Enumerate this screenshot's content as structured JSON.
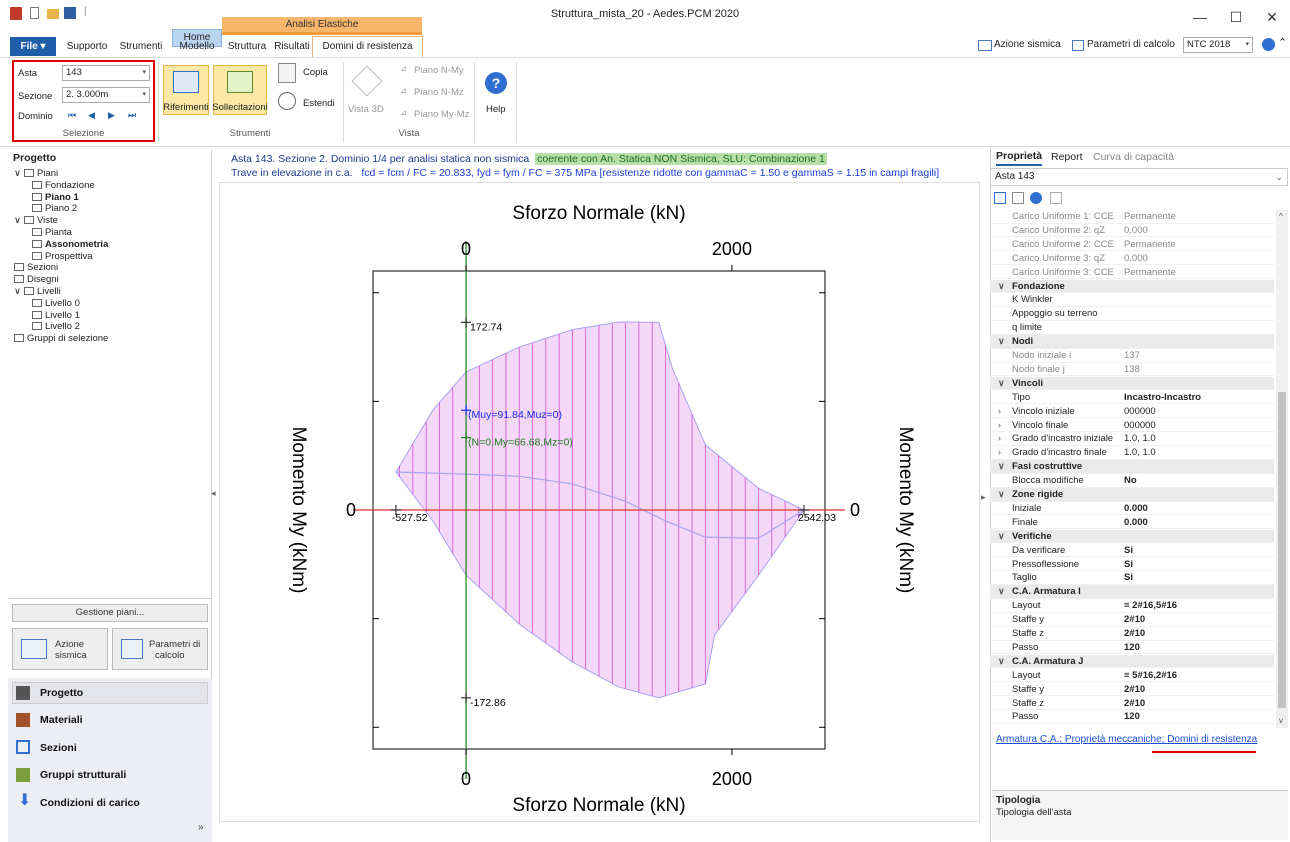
{
  "window": {
    "title": "Struttura_mista_20 - Aedes.PCM 2020",
    "minimize": "—",
    "maximize": "☐",
    "close": "✕"
  },
  "menu": {
    "file": "File ▾",
    "tabs": [
      "Supporto",
      "Strumenti",
      "Home",
      "Modello",
      "Struttura",
      "Risultati"
    ],
    "context_header": "Analisi Elastiche",
    "active_tab": "Domini di resistenza"
  },
  "topright": {
    "azione_sismica": "Azione sismica",
    "parametri_calcolo": "Parametri di calcolo",
    "norma": "NTC 2018"
  },
  "ribbon": {
    "selezione": {
      "label": "Selezione",
      "asta_label": "Asta",
      "asta_value": "143",
      "sezione_label": "Sezione",
      "sezione_value": "2. 3.000m",
      "dominio_label": "Dominio",
      "nav": [
        "⏮",
        "◀",
        "▶",
        "⏭"
      ]
    },
    "strumenti": {
      "label": "Strumenti",
      "riferimenti": "Riferimenti",
      "sollecitazioni": "Sollecitazioni",
      "copia": "Copia",
      "estendi": "Estendi"
    },
    "vista": {
      "label": "Vista",
      "vista3d": "Vista 3D",
      "piano_nmy": "Piano N-My",
      "piano_nmz": "Piano N-Mz",
      "piano_mymz": "Piano My-Mz"
    },
    "help": "Help"
  },
  "left_panel": {
    "title": "Progetto",
    "tree": [
      {
        "label": "Piani",
        "level": 0,
        "expand": "∨"
      },
      {
        "label": "Fondazione",
        "level": 1
      },
      {
        "label": "Piano 1",
        "level": 1,
        "bold": true
      },
      {
        "label": "Piano 2",
        "level": 1
      },
      {
        "label": "Viste",
        "level": 0,
        "expand": "∨"
      },
      {
        "label": "Pianta",
        "level": 1
      },
      {
        "label": "Assonometria",
        "level": 1,
        "bold": true
      },
      {
        "label": "Prospettiva",
        "level": 1
      },
      {
        "label": "Sezioni",
        "level": 0
      },
      {
        "label": "Disegni",
        "level": 0
      },
      {
        "label": "Livelli",
        "level": 0,
        "expand": "∨"
      },
      {
        "label": "Livello 0",
        "level": 1
      },
      {
        "label": "Livello 1",
        "level": 1
      },
      {
        "label": "Livello 2",
        "level": 1
      },
      {
        "label": "Gruppi di selezione",
        "level": 0
      }
    ],
    "gestione_piani": "Gestione piani...",
    "azione_sismica_btn": [
      "Azione",
      "sismica"
    ],
    "parametri_btn": [
      "Parametri di",
      "calcolo"
    ],
    "nav": [
      "Progetto",
      "Materiali",
      "Sezioni",
      "Gruppi strutturali",
      "Condizioni di carico"
    ],
    "more": "»"
  },
  "info": {
    "line1_prefix": "Asta 143. Sezione 2. Dominio 1/4 per analisi statica non sismica",
    "line1_green": "coerente con An. Statica NON Sismica, SLU: Combinazione 1",
    "line2_prefix": "Trave in elevazione in c.a.",
    "line2_blue": "fcd = fcm  /  FC = 20.833, fyd = fym  /  FC = 375 MPa  [resistenze ridotte con gammaC = 1.50 e gammaS = 1.15 in campi fragili]"
  },
  "chart_data": {
    "type": "area",
    "title_top": "Sforzo Normale (kN)",
    "title_bottom": "Sforzo Normale (kN)",
    "ylabel_left": "Momento My (kNm)",
    "ylabel_right": "Momento My (kNm)",
    "x_ticks": [
      "0",
      "2000"
    ],
    "y_zero": "0",
    "x_range": [
      -700,
      2700
    ],
    "y_range": [
      -220,
      220
    ],
    "domain": {
      "upper": [
        [
          -527.52,
          35
        ],
        [
          -250,
          91.84
        ],
        [
          0,
          127
        ],
        [
          400,
          150
        ],
        [
          800,
          166
        ],
        [
          1150,
          173
        ],
        [
          1450,
          172.74
        ],
        [
          1550,
          131
        ],
        [
          1800,
          60
        ],
        [
          2200,
          20
        ],
        [
          2542.03,
          0
        ]
      ],
      "lower": [
        [
          -527.52,
          35
        ],
        [
          -250,
          -10
        ],
        [
          0,
          -60
        ],
        [
          400,
          -105
        ],
        [
          800,
          -140
        ],
        [
          1150,
          -163
        ],
        [
          1450,
          -172.86
        ],
        [
          1800,
          -160
        ],
        [
          1870,
          -115
        ],
        [
          2200,
          -60
        ],
        [
          2542.03,
          0
        ]
      ],
      "hatch_step_kN": 100
    },
    "inner_curve": [
      [
        -527.52,
        35
      ],
      [
        0,
        33
      ],
      [
        400,
        31
      ],
      [
        800,
        24
      ],
      [
        1200,
        8
      ],
      [
        1500,
        -10
      ],
      [
        1800,
        -25
      ],
      [
        2200,
        -26
      ],
      [
        2542.03,
        0
      ]
    ],
    "labels": {
      "my_max": "172.74",
      "my_min": "-172.86",
      "n_min": "-527.52",
      "n_max": "2542.03",
      "point_blue": "(Muy=91.84,Muz=0)",
      "point_green": "(N=0,My=66.68,Mz=0)"
    },
    "point_blue": [
      0,
      91.84
    ],
    "point_green": [
      0,
      66.68
    ],
    "colors": {
      "fill": "#f3d9f7",
      "hatch": "#d64bd6",
      "outline": "#a7a4f0",
      "axis_x": "#e03030",
      "axis_y": "#2a8a2a",
      "blue": "#1a2ae6",
      "green": "#1d7a1d"
    }
  },
  "right_panel": {
    "tabs": [
      "Proprietà",
      "Report",
      "Curva di capacità"
    ],
    "asta": "Asta 143",
    "rows": [
      {
        "k": "Carico Uniforme 1: CCE",
        "v": "Permanente",
        "ro": true
      },
      {
        "k": "Carico Uniforme 2: qZ",
        "v": "0.000",
        "ro": true
      },
      {
        "k": "Carico Uniforme 2: CCE",
        "v": "Permanente",
        "ro": true
      },
      {
        "k": "Carico Uniforme 3: qZ",
        "v": "0.000",
        "ro": true
      },
      {
        "k": "Carico Uniforme 3: CCE",
        "v": "Permanente",
        "ro": true
      },
      {
        "cat": "Fondazione"
      },
      {
        "k": "K Winkler",
        "v": ""
      },
      {
        "k": "Appoggio su terreno",
        "v": ""
      },
      {
        "k": "q limite",
        "v": ""
      },
      {
        "cat": "Nodi"
      },
      {
        "k": "Nodo iniziale i",
        "v": "137",
        "ro": true
      },
      {
        "k": "Nodo finale j",
        "v": "138",
        "ro": true
      },
      {
        "cat": "Vincoli"
      },
      {
        "k": "Tipo",
        "v": "Incastro-Incastro",
        "b": true
      },
      {
        "k": "Vincolo iniziale",
        "v": "000000",
        "x": true
      },
      {
        "k": "Vincolo finale",
        "v": "000000",
        "x": true
      },
      {
        "k": "Grado d'incastro iniziale",
        "v": "1.0, 1.0",
        "x": true
      },
      {
        "k": "Grado d'incastro finale",
        "v": "1.0, 1.0",
        "x": true
      },
      {
        "cat": "Fasi costruttive"
      },
      {
        "k": "Blocca modifiche",
        "v": "No",
        "b": true
      },
      {
        "cat": "Zone rigide"
      },
      {
        "k": "Iniziale",
        "v": "0.000",
        "b": true
      },
      {
        "k": "Finale",
        "v": "0.000",
        "b": true
      },
      {
        "cat": "Verifiche"
      },
      {
        "k": "Da verificare",
        "v": "Si",
        "b": true
      },
      {
        "k": "Pressoflessione",
        "v": "Si",
        "b": true
      },
      {
        "k": "Taglio",
        "v": "Si",
        "b": true
      },
      {
        "cat": "C.A. Armatura I"
      },
      {
        "k": "Layout",
        "v": "≡ 2#16,5#16",
        "b": true
      },
      {
        "k": "Staffe y",
        "v": "2#10",
        "b": true
      },
      {
        "k": "Staffe z",
        "v": "2#10",
        "b": true
      },
      {
        "k": "Passo",
        "v": "120",
        "b": true
      },
      {
        "cat": "C.A. Armatura J"
      },
      {
        "k": "Layout",
        "v": "≡ 5#16,2#16",
        "b": true
      },
      {
        "k": "Staffe y",
        "v": "2#10",
        "b": true
      },
      {
        "k": "Staffe z",
        "v": "2#10",
        "b": true
      },
      {
        "k": "Passo",
        "v": "120",
        "b": true
      }
    ],
    "links": [
      "Armatura C.A.",
      "Proprietà meccaniche",
      "Domini di resistenza"
    ],
    "tipologia_title": "Tipologia",
    "tipologia_desc": "Tipologia dell'asta"
  }
}
